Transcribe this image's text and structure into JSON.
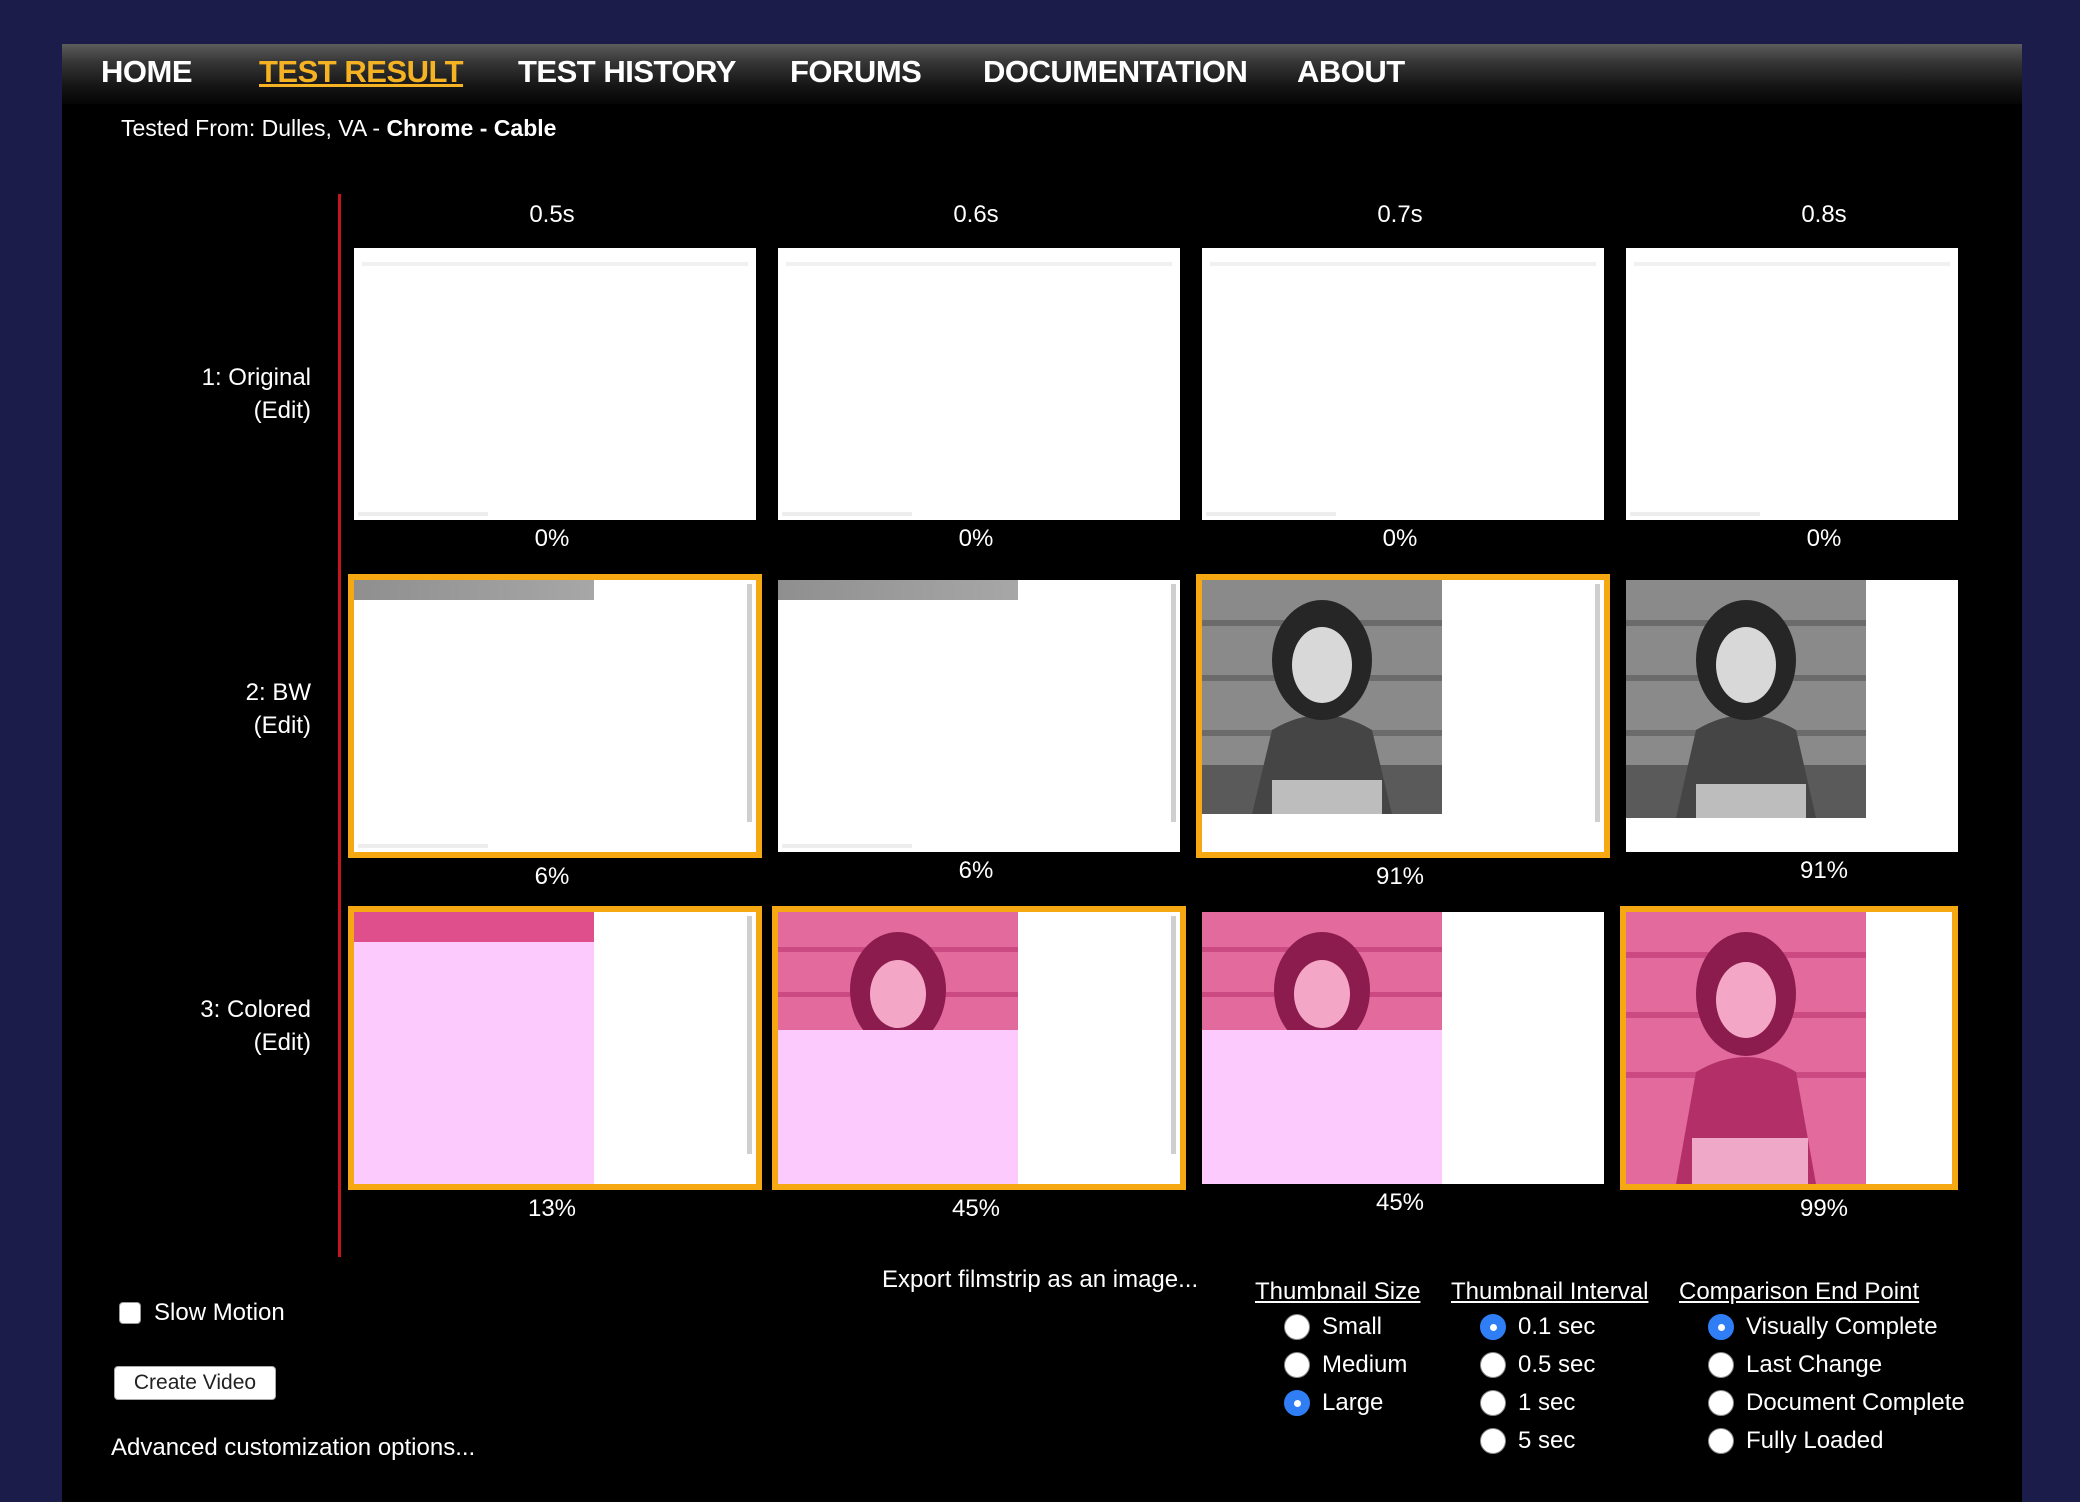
{
  "nav": {
    "items": [
      "HOME",
      "TEST RESULT",
      "TEST HISTORY",
      "FORUMS",
      "DOCUMENTATION",
      "ABOUT"
    ],
    "active": "TEST RESULT"
  },
  "tested_from": {
    "prefix": "Tested From: Dulles, VA - ",
    "browser": "Chrome",
    "separator": " - ",
    "connection": "Cable"
  },
  "filmstrip": {
    "times": [
      "0.5s",
      "0.6s",
      "0.7s",
      "0.8s"
    ],
    "rows": [
      {
        "label": "1: Original",
        "edit": "(Edit)",
        "percents": [
          "0%",
          "0%",
          "0%",
          "0%"
        ],
        "changed": [
          false,
          false,
          false,
          false
        ]
      },
      {
        "label": "2: BW",
        "edit": "(Edit)",
        "percents": [
          "6%",
          "6%",
          "91%",
          "91%"
        ],
        "changed": [
          true,
          false,
          true,
          false
        ]
      },
      {
        "label": "3: Colored",
        "edit": "(Edit)",
        "percents": [
          "13%",
          "45%",
          "45%",
          "99%"
        ],
        "changed": [
          true,
          true,
          false,
          true
        ]
      }
    ]
  },
  "controls": {
    "slow_motion": "Slow Motion",
    "create_video": "Create Video",
    "advanced": "Advanced customization options...",
    "export": "Export filmstrip as an image..."
  },
  "options": {
    "thumbnail_size": {
      "title": "Thumbnail Size",
      "items": [
        "Small",
        "Medium",
        "Large"
      ],
      "selected": "Large"
    },
    "thumbnail_interval": {
      "title": "Thumbnail Interval",
      "items": [
        "0.1 sec",
        "0.5 sec",
        "1 sec",
        "5 sec"
      ],
      "selected": "0.1 sec"
    },
    "end_point": {
      "title": "Comparison End Point",
      "items": [
        "Visually Complete",
        "Last Change",
        "Document Complete",
        "Fully Loaded"
      ],
      "selected": "Visually Complete"
    }
  },
  "colors": {
    "accent": "#f5b324",
    "thumb_border": "#f5a812",
    "pink": "#fccafc",
    "radio_selected": "#2f7ef6",
    "page_bg": "#1c1c4a"
  }
}
